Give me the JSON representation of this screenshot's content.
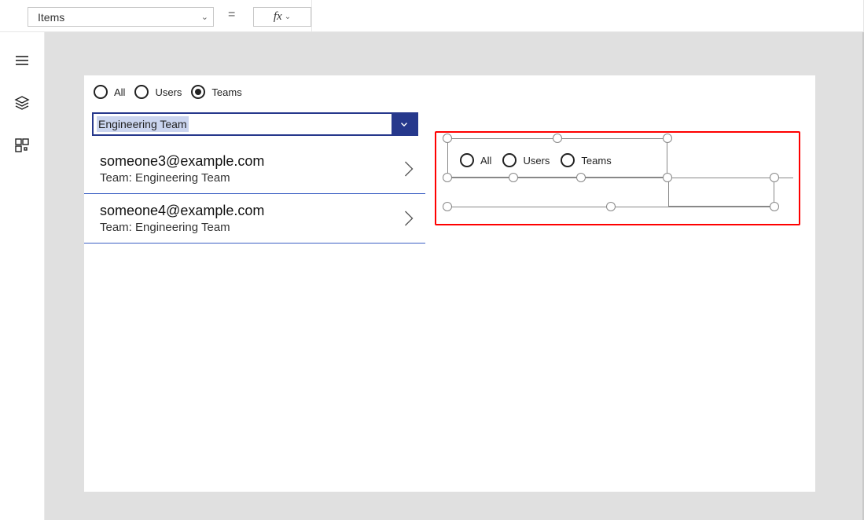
{
  "property_selector": {
    "value": "Items"
  },
  "equals": "=",
  "fx_label": "fx",
  "radios": {
    "all": "All",
    "users": "Users",
    "teams": "Teams",
    "selected": "teams"
  },
  "dropdown": {
    "value": "Engineering Team"
  },
  "results": [
    {
      "email": "someone3@example.com",
      "teamline": "Team: Engineering Team"
    },
    {
      "email": "someone4@example.com",
      "teamline": "Team: Engineering Team"
    }
  ],
  "designer_radios": {
    "all": "All",
    "users": "Users",
    "teams": "Teams"
  }
}
